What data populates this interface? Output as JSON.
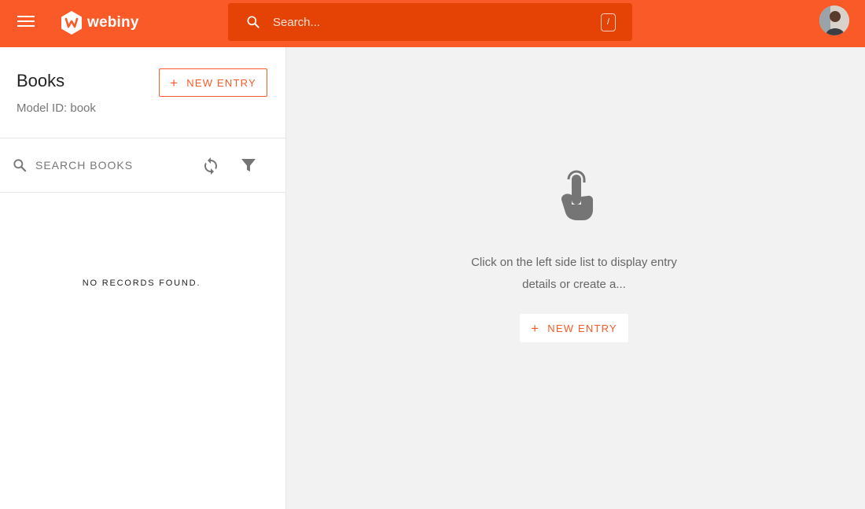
{
  "header": {
    "brand": "webiny",
    "search_placeholder": "Search...",
    "shortcut_key": "/",
    "menu_icon": "hamburger-icon",
    "avatar_icon": "user-avatar"
  },
  "sidebar": {
    "title": "Books",
    "model_id": "Model ID: book",
    "new_entry_label": "NEW ENTRY",
    "search_placeholder": "SEARCH BOOKS",
    "refresh_icon": "refresh-icon",
    "filter_icon": "filter-icon",
    "empty_message": "NO RECORDS FOUND."
  },
  "main": {
    "empty_icon": "touch-hand-icon",
    "empty_text": "Click on the left side list to display entry details or create a...",
    "new_entry_label": "NEW ENTRY"
  },
  "colors": {
    "brand": "#fa5a28",
    "search_bg": "#e54205",
    "panel_bg": "#f2f2f2",
    "icon_gray": "#757575"
  }
}
